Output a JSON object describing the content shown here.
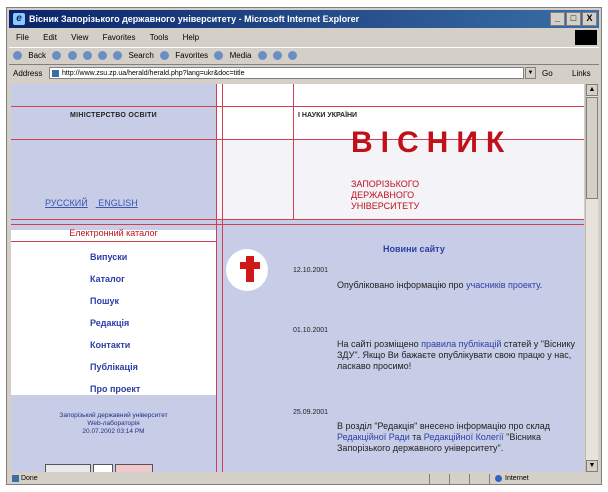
{
  "window": {
    "title": "Вісник Запорізького державного університету - Microsoft Internet Explorer",
    "controls": {
      "minimize": "_",
      "maximize": "□",
      "close": "X"
    }
  },
  "menu": [
    "File",
    "Edit",
    "View",
    "Favorites",
    "Tools",
    "Help"
  ],
  "toolbar": {
    "back": "Back",
    "search": "Search",
    "favorites": "Favorites",
    "media": "Media"
  },
  "address": {
    "label": "Address",
    "url": "http://www.zsu.zp.ua/herald/herald.php?lang=ukr&doc=title",
    "go": "Go",
    "links": "Links"
  },
  "status": {
    "left": "Done",
    "zone": "Internet"
  },
  "page": {
    "ministry": "МІНІСТЕРСТВО ОСВІТИ",
    "science": "І НАУКИ УКРАЇНИ",
    "title": "ВІСНИК",
    "subtitle_lines": [
      "ЗАПОРІЗЬКОГО",
      "ДЕРЖАВНОГО",
      "УНІВЕРСИТЕТУ"
    ],
    "lang_ru": "РУССКИЙ",
    "lang_en": "ENGLISH",
    "catalog_header": "Електронний каталог",
    "menu_items": [
      "Випуски",
      "Каталог",
      "Пошук",
      "Редакція",
      "Контакти",
      "Публікація",
      "Про проект"
    ],
    "footer_lines": [
      "Запорізький державний університет",
      "Web-лабораторія",
      "20.07.2002 03:14 PM"
    ],
    "news_heading": "Новини сайту",
    "news": [
      {
        "date": "12.10.2001",
        "parts": [
          {
            "t": "Опубліковано інформацію про ",
            "link": false
          },
          {
            "t": "учасників проекту",
            "link": true
          },
          {
            "t": ".",
            "link": false
          }
        ]
      },
      {
        "date": "01.10.2001",
        "parts": [
          {
            "t": "На сайті розміщено ",
            "link": false
          },
          {
            "t": "правила публікацій",
            "link": true
          },
          {
            "t": " статей у \"Віснику ЗДУ\". Якщо Ви бажаєте опублікувати свою працю у нас, ласкаво просимо!",
            "link": false
          }
        ]
      },
      {
        "date": "25.09.2001",
        "parts": [
          {
            "t": "В розділ \"Редакція\" внесено інформацію про склад ",
            "link": false
          },
          {
            "t": "Редакційної Ради",
            "link": true
          },
          {
            "t": " та ",
            "link": false
          },
          {
            "t": "Редакційної Колегії",
            "link": true
          },
          {
            "t": " \"Вісника Запорізького державного університету\".",
            "link": false
          }
        ]
      }
    ]
  }
}
